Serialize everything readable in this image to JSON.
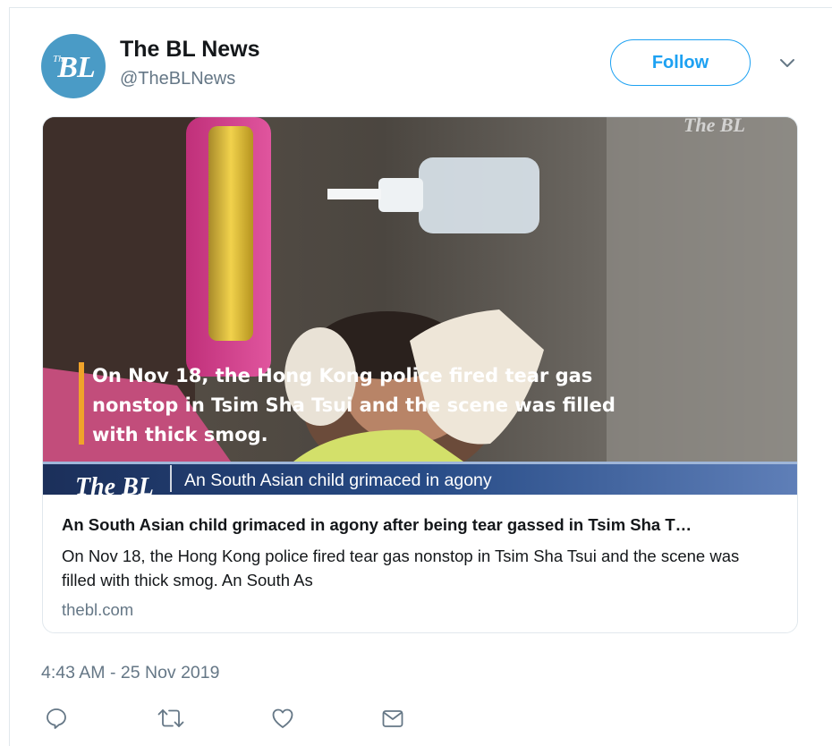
{
  "account": {
    "avatar_small": "The",
    "avatar_text": "BL",
    "name": "The BL News",
    "handle": "@TheBLNews"
  },
  "follow_label": "Follow",
  "card": {
    "image": {
      "watermark": "The BL",
      "caption_lines": [
        "On Nov 18, the Hong Kong police fired tear gas",
        "nonstop in Tsim Sha Tsui and the scene was filled",
        "with thick smog."
      ],
      "banner_logo": "The BL",
      "banner_text": "An South Asian child grimaced in agony"
    },
    "title": "An South Asian child grimaced in agony after being tear gassed in Tsim Sha T…",
    "description": "On Nov 18, the Hong Kong police fired tear gas nonstop in Tsim Sha Tsui and the scene was filled with thick smog. An South As",
    "domain": "thebl.com"
  },
  "timestamp": "4:43 AM - 25 Nov 2019",
  "actions": [
    {
      "icon": "reply-icon"
    },
    {
      "icon": "retweet-icon"
    },
    {
      "icon": "like-icon"
    },
    {
      "icon": "message-icon"
    }
  ],
  "colors": {
    "accent": "#1da1f2",
    "avatar_bg": "#4a9bc6",
    "secondary_text": "#657786",
    "caption_bar": "#f0a32a",
    "banner_bg": "#1f3a6b"
  }
}
